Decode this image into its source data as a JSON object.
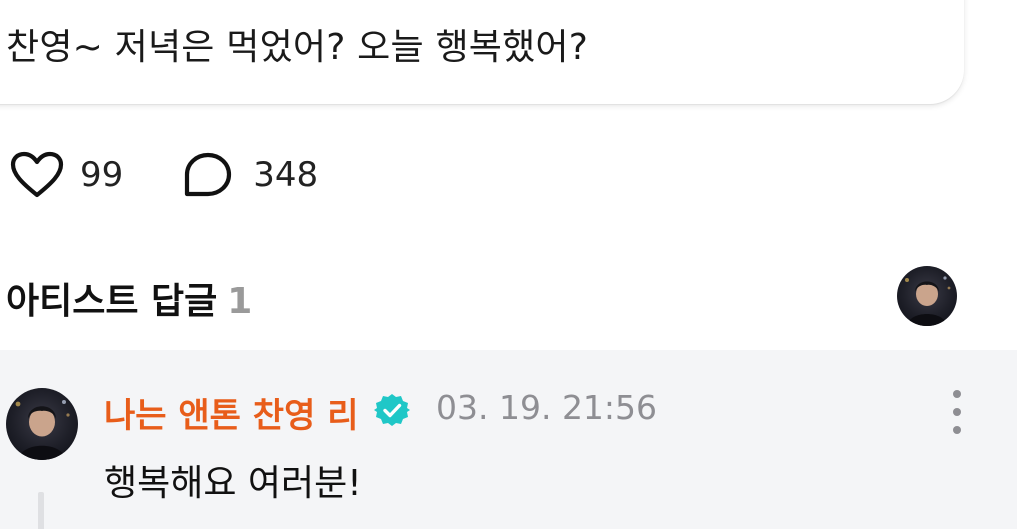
{
  "post": {
    "text": "찬영~ 저녁은 먹었어? 오늘 행복했어?"
  },
  "reactions": {
    "likes_count": "99",
    "comments_count": "348",
    "like_icon": "heart-icon",
    "comment_icon": "speech-bubble-icon"
  },
  "artist_replies": {
    "title": "아티스트 답글",
    "count": "1"
  },
  "reply": {
    "author": "나는 앤톤 찬영 리",
    "verified_icon": "verified-badge-icon",
    "timestamp": "03. 19. 21:56",
    "text": "행복해요 여러분!",
    "more_icon": "more-vertical-icon"
  },
  "colors": {
    "author_name": "#e85d1a",
    "verified_badge": "#1fc7c7",
    "reply_background": "#f4f5f7",
    "muted_text": "#8e8e93"
  }
}
